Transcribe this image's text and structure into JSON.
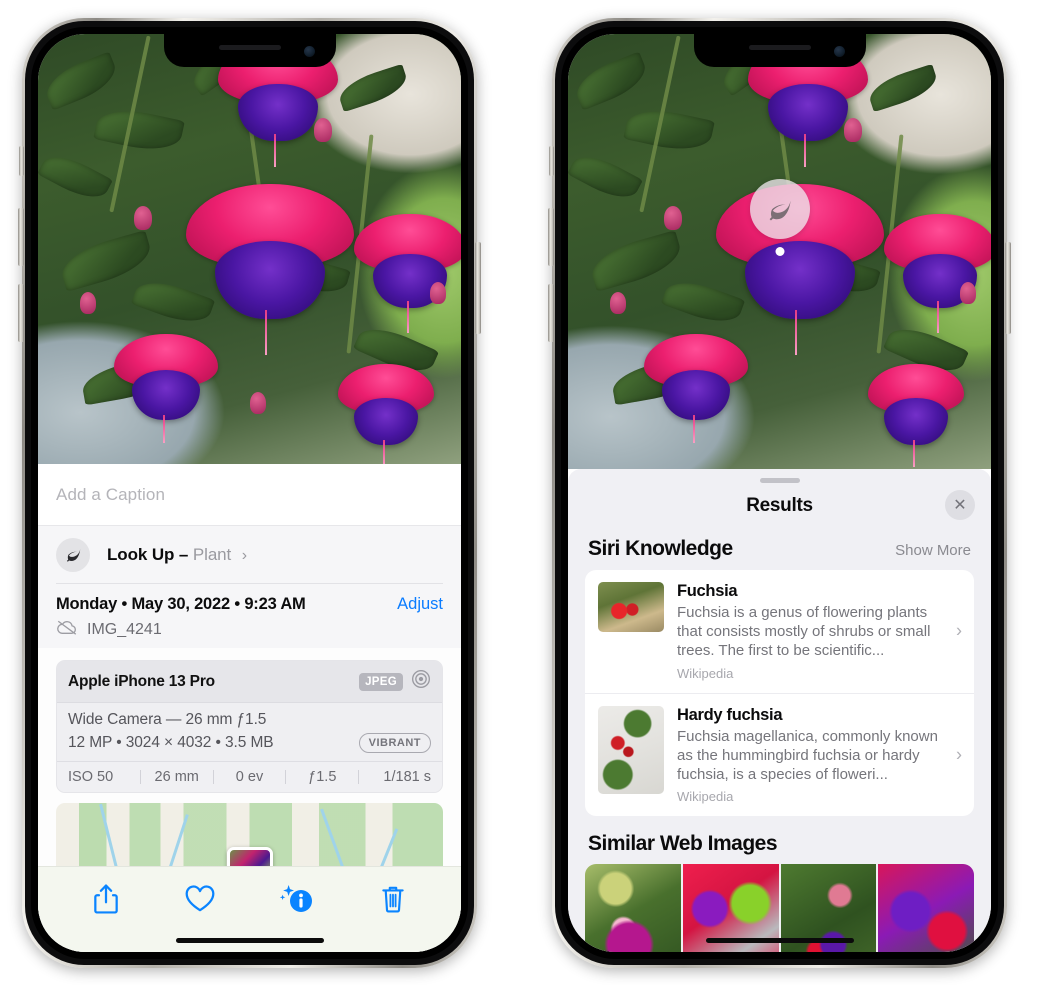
{
  "left_phone": {
    "caption": {
      "placeholder": "Add a Caption",
      "value": ""
    },
    "lookup": {
      "label": "Look Up",
      "dash": "–",
      "subject": "Plant",
      "chevron": "›",
      "icon": "leaf-icon"
    },
    "meta": {
      "date": "Monday • May 30, 2022 • 9:23 AM",
      "adjust_label": "Adjust",
      "filename": "IMG_4241",
      "cloud_icon": "icloud-slash-icon"
    },
    "camera_card": {
      "device": "Apple iPhone 13 Pro",
      "format_badge": "JPEG",
      "lens_icon": "aperture-icon",
      "lens_line": "Wide Camera — 26 mm ƒ1.5",
      "specs_line": "12 MP • 3024 × 4032 • 3.5 MB",
      "color_badge": "VIBRANT",
      "exif": [
        "ISO 50",
        "26 mm",
        "0 ev",
        "ƒ1.5",
        "1/181 s"
      ]
    },
    "toolbar": [
      {
        "name": "share-button",
        "icon": "share-icon"
      },
      {
        "name": "favorite-button",
        "icon": "heart-icon"
      },
      {
        "name": "info-button",
        "icon": "info-sparkle-icon"
      },
      {
        "name": "delete-button",
        "icon": "trash-icon"
      }
    ]
  },
  "right_phone": {
    "photo_badge": {
      "icon": "leaf-icon"
    },
    "sheet": {
      "title": "Results",
      "close_icon": "close-icon",
      "siri_section": {
        "title": "Siri Knowledge",
        "show_more": "Show More",
        "items": [
          {
            "title": "Fuchsia",
            "description": "Fuchsia is a genus of flowering plants that consists mostly of shrubs or small trees. The first to be scientific...",
            "source": "Wikipedia",
            "chevron": "›"
          },
          {
            "title": "Hardy fuchsia",
            "description": "Fuchsia magellanica, commonly known as the hummingbird fuchsia or hardy fuchsia, is a species of floweri...",
            "source": "Wikipedia",
            "chevron": "›"
          }
        ]
      },
      "web_section": {
        "title": "Similar Web Images",
        "thumbnails": [
          "fuchsia-web-1",
          "fuchsia-web-2",
          "fuchsia-web-3",
          "fuchsia-web-4"
        ]
      }
    }
  },
  "colors": {
    "accent_blue": "#0a84ff",
    "sheet_bg": "#f0f0f4",
    "card_white": "#ffffff",
    "secondary_text": "#75757b"
  }
}
